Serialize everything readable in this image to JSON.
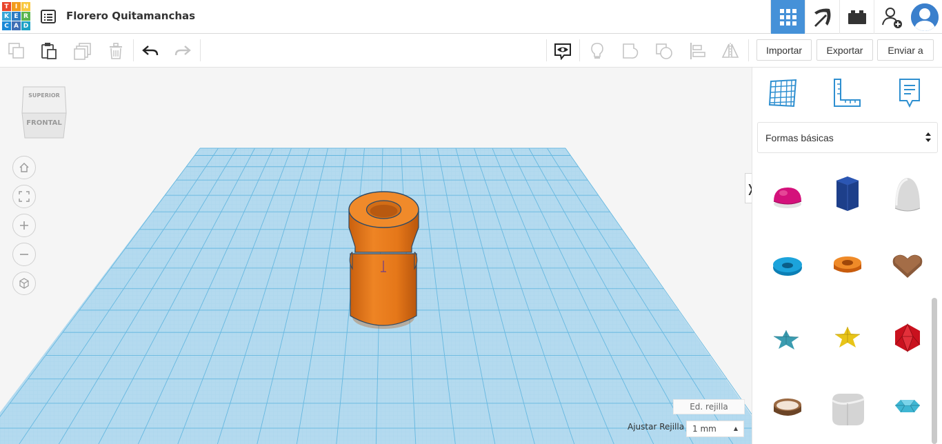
{
  "app": {
    "logo_letters": [
      "T",
      "I",
      "N",
      "K",
      "E",
      "R",
      "C",
      "A",
      "D"
    ],
    "design_title": "Florero Quitamanchas"
  },
  "header_icons": [
    "grid-view-icon",
    "pickaxe-icon",
    "bricks-icon",
    "add-user-icon",
    "profile-avatar-icon"
  ],
  "toolbar": {
    "import_label": "Importar",
    "export_label": "Exportar",
    "send_label": "Enviar a"
  },
  "viewcube": {
    "top_label": "SUPERIOR",
    "front_label": "FRONTAL"
  },
  "viewport": {
    "edit_grid_label": "Ed. rejilla",
    "snap_grid_label": "Ajustar Rejilla",
    "snap_grid_value": "1 mm"
  },
  "panel": {
    "category_selected": "Formas básicas",
    "shapes": [
      "hemisphere",
      "polygon",
      "paraboloid",
      "torus",
      "tube",
      "heart",
      "star-teal",
      "star-yellow",
      "icosahedron",
      "ring",
      "round-roof",
      "gem"
    ]
  },
  "colors": {
    "accent_blue": "#4591d8",
    "workplane": "#b6dcf0",
    "grid_line": "#6fbfe6",
    "object_orange": "#e97a1c"
  }
}
